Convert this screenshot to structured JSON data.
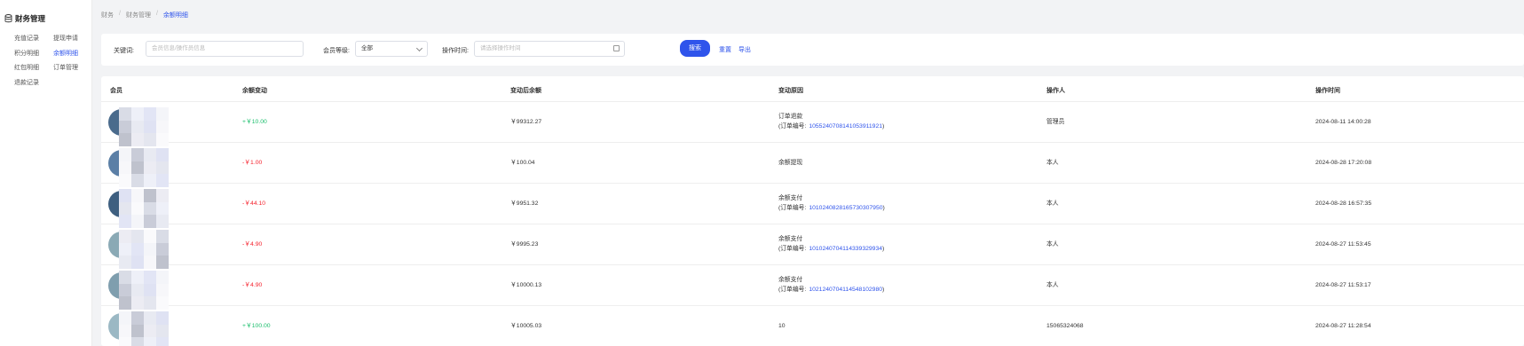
{
  "sidebar": {
    "title": "财务管理",
    "items": [
      "充值记录",
      "提现申请",
      "积分明细",
      "余额明细",
      "红包明细",
      "订单管理",
      "退款记录"
    ],
    "active_index": 3
  },
  "breadcrumb": [
    "财务",
    "财务管理",
    "余额明细"
  ],
  "filters": {
    "keyword_label": "关键词:",
    "keyword_placeholder": "会员信息/操作员信息",
    "level_label": "会员等级:",
    "level_value": "全部",
    "time_label": "操作时间:",
    "time_placeholder": "请选择操作时间",
    "search_button": "搜索",
    "reset_link": "重置",
    "export_link": "导出"
  },
  "table": {
    "columns": [
      "会员",
      "余额变动",
      "变动后余额",
      "变动原因",
      "操作人",
      "操作时间"
    ],
    "rows": [
      {
        "change": "+￥10.00",
        "sign": "pos",
        "balance": "￥99312.27",
        "reason": "订单退款",
        "order_label": "(订单编号:",
        "order_no": "1055240708141053911921",
        "order_close": ")",
        "operator": "管理员",
        "time": "2024-08-11 14:00:28",
        "avatar_color": "#4a6b8c"
      },
      {
        "change": "-￥1.00",
        "sign": "neg",
        "balance": "￥100.04",
        "reason": "余额提现",
        "order_label": "",
        "order_no": "",
        "order_close": "",
        "operator": "本人",
        "time": "2024-08-28 17:20:08",
        "avatar_color": "#5b7fa6"
      },
      {
        "change": "-￥44.10",
        "sign": "neg",
        "balance": "￥9951.32",
        "reason": "余额支付",
        "order_label": "(订单编号:",
        "order_no": "1010240828165730307950",
        "order_close": ")",
        "operator": "本人",
        "time": "2024-08-28 16:57:35",
        "avatar_color": "#3e5f80"
      },
      {
        "change": "-￥4.90",
        "sign": "neg",
        "balance": "￥9995.23",
        "reason": "余额支付",
        "order_label": "(订单编号:",
        "order_no": "1010240704114339329934",
        "order_close": ")",
        "operator": "本人",
        "time": "2024-08-27 11:53:45",
        "avatar_color": "#8aa9b5"
      },
      {
        "change": "-￥4.90",
        "sign": "neg",
        "balance": "￥10000.13",
        "reason": "余额支付",
        "order_label": "(订单编号:",
        "order_no": "1021240704114548102980",
        "order_close": ")",
        "operator": "本人",
        "time": "2024-08-27 11:53:17",
        "avatar_color": "#7f9eae"
      },
      {
        "change": "+￥100.00",
        "sign": "pos",
        "balance": "￥10005.03",
        "reason": "10",
        "order_label": "",
        "order_no": "",
        "order_close": "",
        "operator": "15065324068",
        "time": "2024-08-27 11:28:54",
        "avatar_color": "#9bb8c4"
      }
    ]
  }
}
